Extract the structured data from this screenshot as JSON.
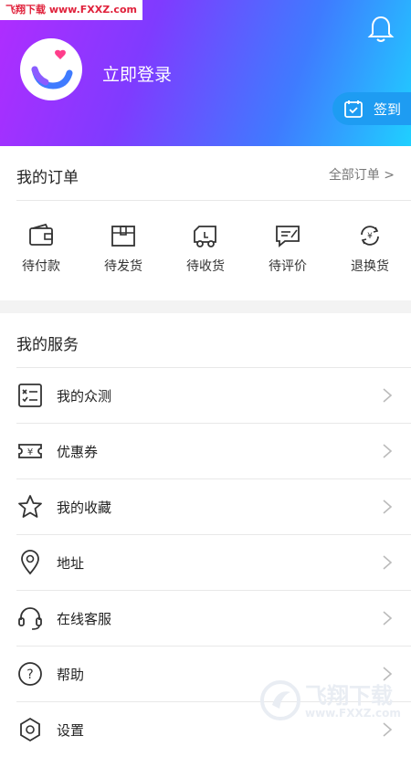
{
  "watermark_top": "飞翔下载 www.FXXZ.com",
  "header": {
    "login_text": "立即登录",
    "signin_label": "签到"
  },
  "orders": {
    "title": "我的订单",
    "all_link": "全部订单 >",
    "items": [
      {
        "label": "待付款",
        "icon": "wallet-icon"
      },
      {
        "label": "待发货",
        "icon": "package-icon"
      },
      {
        "label": "待收货",
        "icon": "truck-icon"
      },
      {
        "label": "待评价",
        "icon": "review-icon"
      },
      {
        "label": "退换货",
        "icon": "exchange-icon"
      }
    ]
  },
  "services": {
    "title": "我的服务",
    "items": [
      {
        "label": "我的众测",
        "icon": "checklist-icon"
      },
      {
        "label": "优惠券",
        "icon": "coupon-icon"
      },
      {
        "label": "我的收藏",
        "icon": "star-icon"
      },
      {
        "label": "地址",
        "icon": "location-icon"
      },
      {
        "label": "在线客服",
        "icon": "headset-icon"
      },
      {
        "label": "帮助",
        "icon": "help-icon"
      },
      {
        "label": "设置",
        "icon": "settings-icon"
      }
    ]
  },
  "watermark_bottom": {
    "title": "飞翔下载",
    "url": "www.FXXZ.com"
  }
}
